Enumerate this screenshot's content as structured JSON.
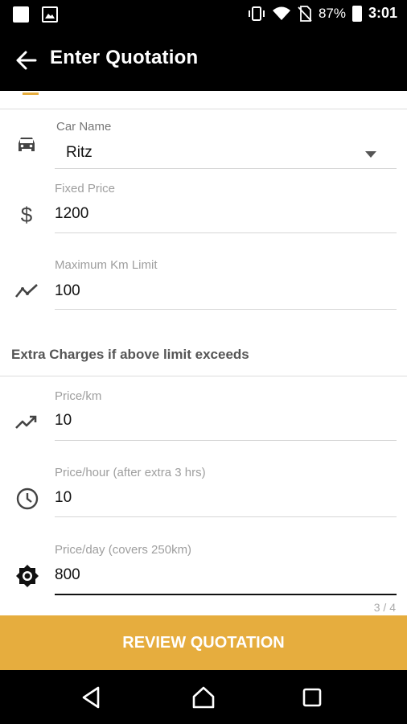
{
  "statusbar": {
    "battery": "87%",
    "time": "3:01"
  },
  "appbar": {
    "title": "Enter Quotation"
  },
  "form": {
    "car_name": {
      "label": "Car Name",
      "value": "Ritz"
    },
    "fixed_price": {
      "label": "Fixed Price",
      "value": "1200"
    },
    "max_km": {
      "label": "Maximum Km Limit",
      "value": "100"
    },
    "section_title": "Extra Charges if above limit exceeds",
    "price_km": {
      "label": "Price/km",
      "value": "10"
    },
    "price_hour": {
      "label": "Price/hour (after extra 3 hrs)",
      "value": "10"
    },
    "price_day": {
      "label": "Price/day (covers 250km)",
      "value": "800"
    },
    "counter": "3 / 4"
  },
  "footer": {
    "review_label": "REVIEW QUOTATION"
  },
  "colors": {
    "accent": "#e6ad3e",
    "bar": "#000000"
  }
}
